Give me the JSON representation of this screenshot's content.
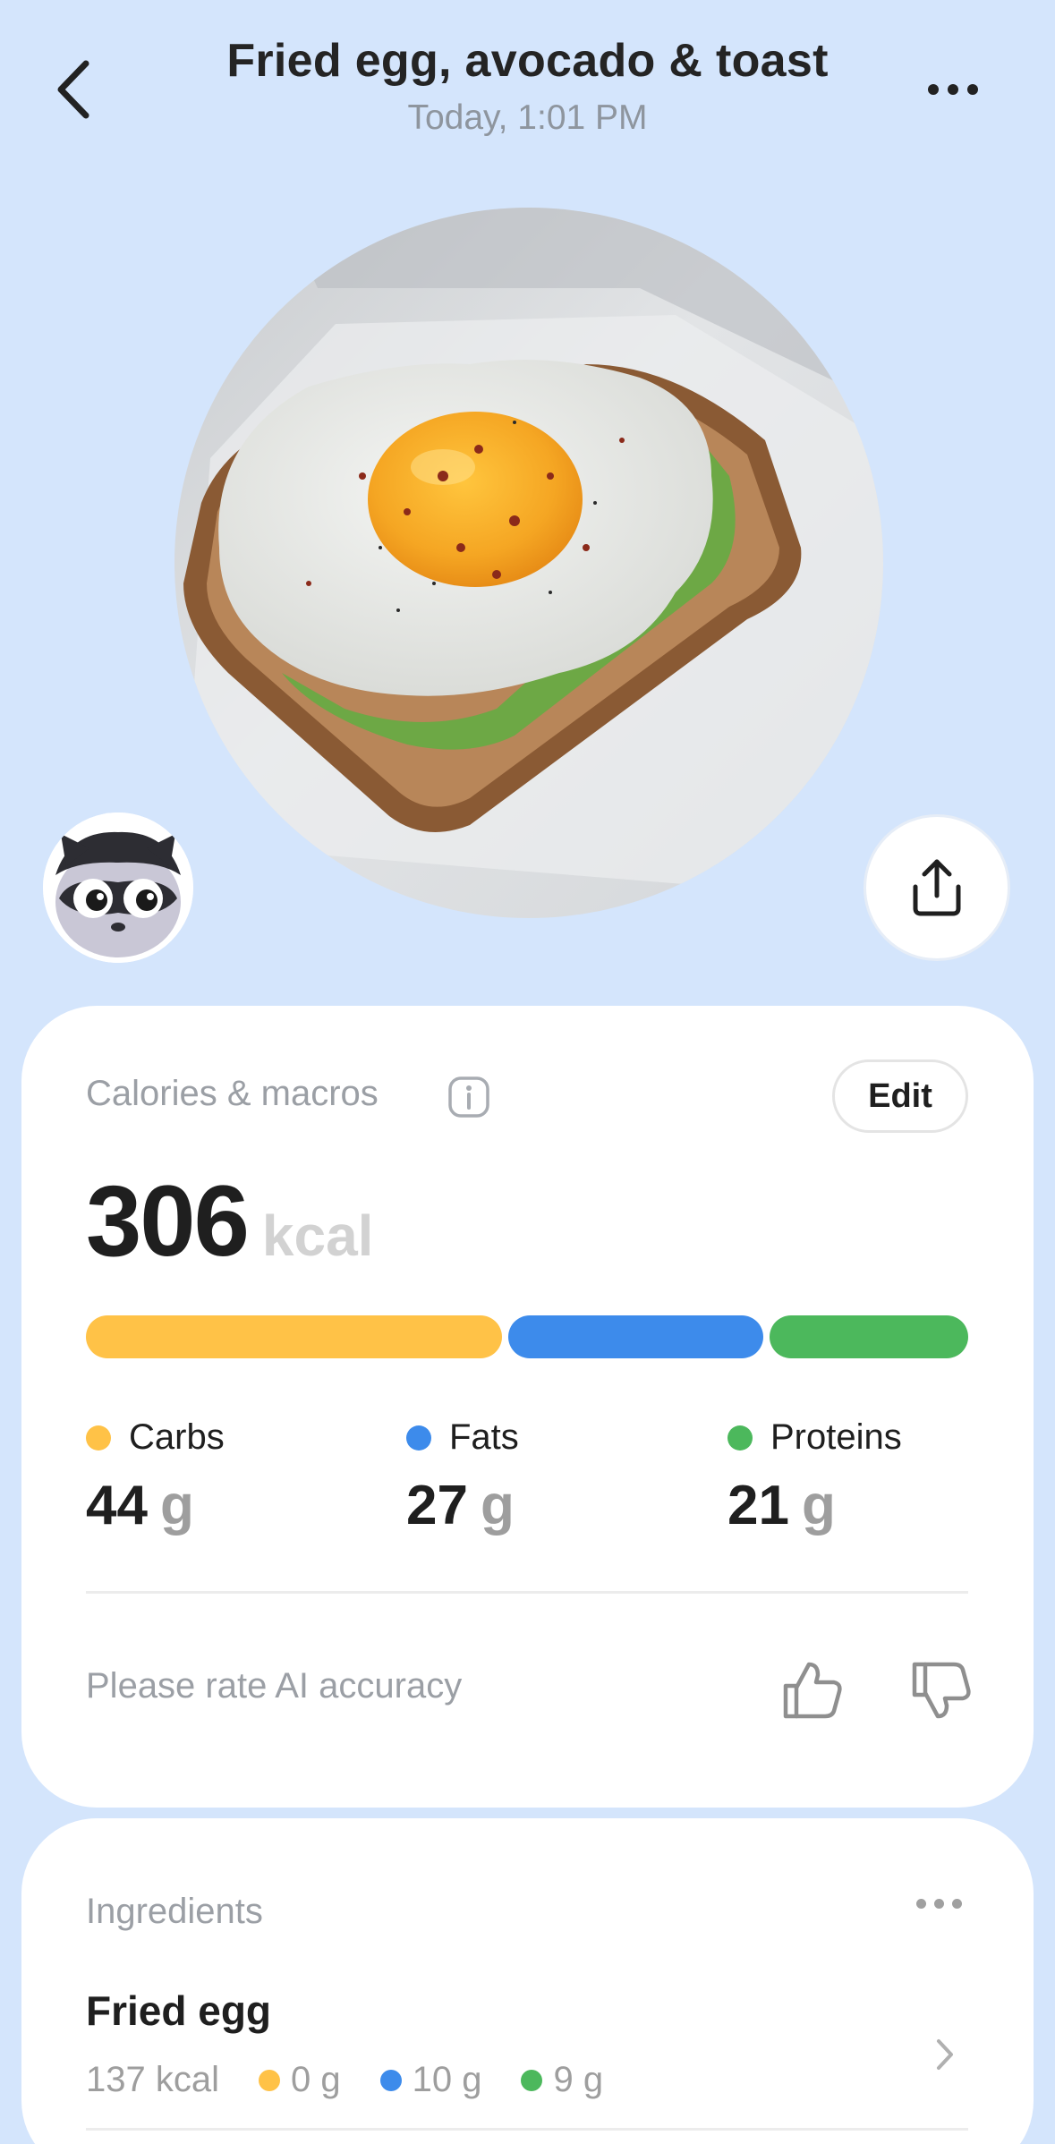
{
  "header": {
    "title": "Fried egg, avocado & toast",
    "subtitle": "Today, 1:01 PM",
    "back_icon": "chevron-left-icon",
    "more_icon": "more-horizontal-icon"
  },
  "photo": {
    "alt": "Fried egg on avocado toast"
  },
  "share_icon": "share-icon",
  "macros_card": {
    "label": "Calories & macros",
    "info_icon": "info-icon",
    "edit_label": "Edit",
    "kcal_value": "306",
    "kcal_unit": "kcal",
    "items": [
      {
        "name": "Carbs",
        "value": "44",
        "unit": "g",
        "grams": 44,
        "color": "#FFC247"
      },
      {
        "name": "Fats",
        "value": "27",
        "unit": "g",
        "grams": 27,
        "color": "#3D8BEB"
      },
      {
        "name": "Proteins",
        "value": "21",
        "unit": "g",
        "grams": 21,
        "color": "#4CB85C"
      }
    ],
    "rate_text": "Please rate AI accuracy",
    "thumb_up_icon": "thumbs-up-icon",
    "thumb_down_icon": "thumbs-down-icon"
  },
  "ingredients_card": {
    "label": "Ingredients",
    "more_icon": "more-horizontal-icon",
    "items": [
      {
        "name": "Fried egg",
        "kcal": "137 kcal",
        "carbs": "0 g",
        "fats": "10 g",
        "proteins": "9 g"
      }
    ]
  },
  "colors": {
    "background": "#D4E5FC",
    "carbs": "#FFC247",
    "fats": "#3D8BEB",
    "proteins": "#4CB85C"
  }
}
